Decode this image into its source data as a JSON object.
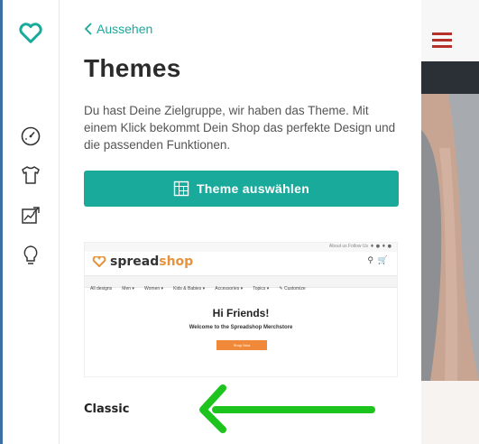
{
  "panel": {
    "back_label": "Aussehen",
    "title": "Themes",
    "description": "Du hast Deine Zielgruppe, wir haben das Theme. Mit einem Klick bekommt Dein Shop das perfekte Design und die passenden Funktionen.",
    "button_label": "Theme auswählen",
    "theme_name": "Classic"
  },
  "preview": {
    "top_text": "About us   Follow Us",
    "brand_spread": "spread",
    "brand_shop": "shop",
    "nav_items": [
      "All designs",
      "Men ▾",
      "Women ▾",
      "Kids & Babies ▾",
      "Accessories ▾",
      "Topics ▾",
      "✎ Customize"
    ],
    "hero_title": "Hi Friends!",
    "hero_subtitle": "Welcome to the Spreadshop Merchstore",
    "hero_button": "Shop Now"
  },
  "rail_icons": [
    "logo-heart-icon",
    "dashboard-gauge-icon",
    "tshirt-icon",
    "image-chart-icon",
    "lightbulb-icon"
  ],
  "colors": {
    "accent": "#1aaa9c",
    "rail_border": "#3d6ea5",
    "arrow": "#1ec41e",
    "hamburger": "#b3322a",
    "brand_orange": "#e8923a"
  }
}
